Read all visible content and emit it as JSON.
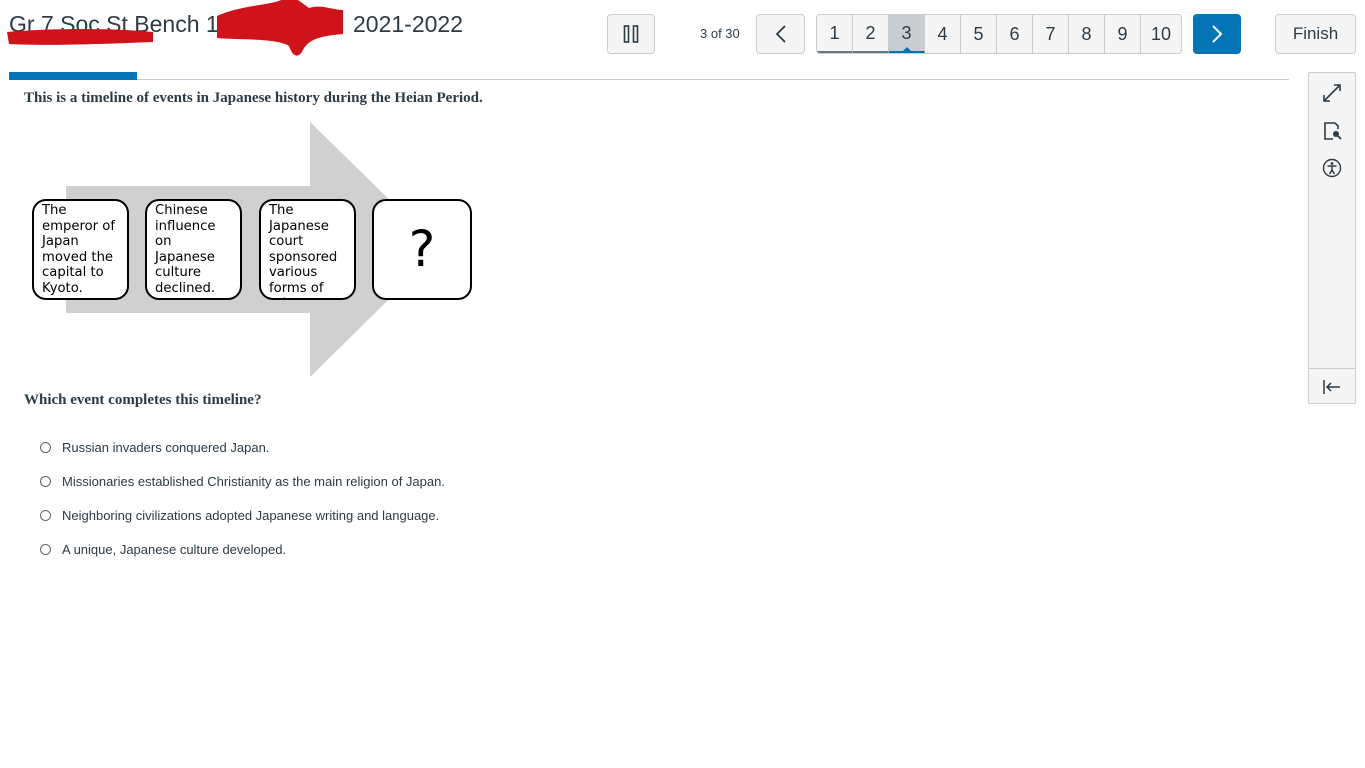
{
  "header": {
    "title_part1": "Gr 7 Soc St Bench 1",
    "title_part2": "2021-2022",
    "pause_icon": "pause-icon",
    "counter": "3 of 30",
    "prev_icon": "chevron-left-icon",
    "next_icon": "chevron-right-icon",
    "finish_label": "Finish",
    "pages": [
      {
        "label": "1",
        "state": "visited"
      },
      {
        "label": "2",
        "state": "visited"
      },
      {
        "label": "3",
        "state": "current"
      },
      {
        "label": "4",
        "state": "unvisited"
      },
      {
        "label": "5",
        "state": "unvisited"
      },
      {
        "label": "6",
        "state": "unvisited"
      },
      {
        "label": "7",
        "state": "unvisited"
      },
      {
        "label": "8",
        "state": "unvisited"
      },
      {
        "label": "9",
        "state": "unvisited"
      },
      {
        "label": "10",
        "state": "unvisited"
      }
    ],
    "accent_color": "#0374b5",
    "redaction_color": "#d0121b"
  },
  "toolbar": {
    "icons": [
      "expand-icon",
      "document-search-icon",
      "accessibility-icon",
      "collapse-panel-icon"
    ]
  },
  "question": {
    "intro": "This is a timeline of events in Japanese history during the Heian Period.",
    "timeline": [
      "The emperor of Japan moved the capital to Kyoto.",
      "Chinese influence on Japanese culture declined.",
      "The Japanese court sponsored various forms of art.",
      "?"
    ],
    "prompt": "Which event completes this timeline?",
    "answers": [
      "Russian invaders conquered Japan.",
      "Missionaries established Christianity as the main religion of Japan.",
      "Neighboring civilizations adopted Japanese writing and language.",
      "A unique, Japanese culture developed."
    ]
  }
}
